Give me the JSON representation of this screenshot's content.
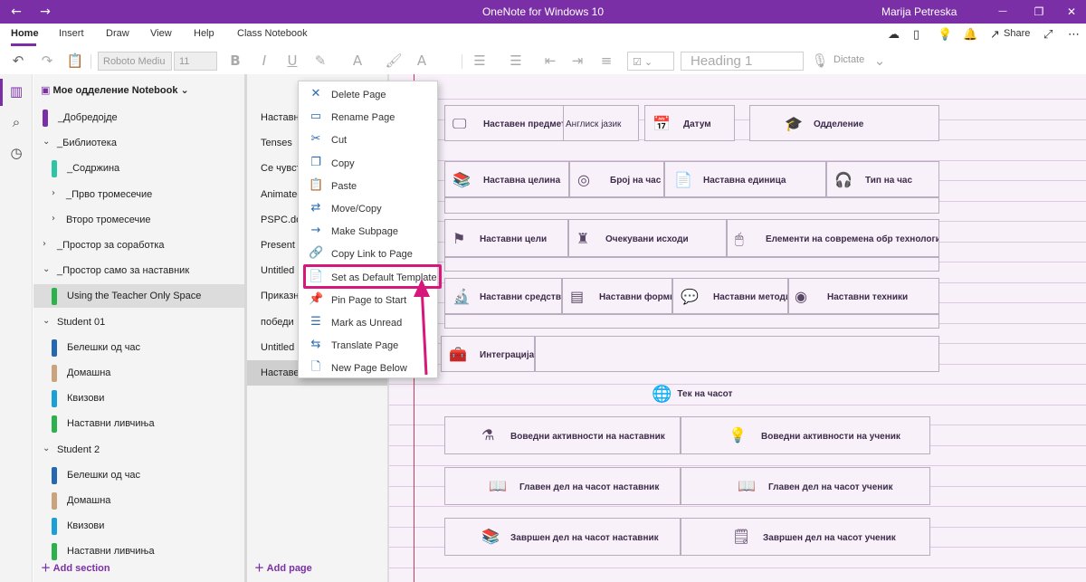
{
  "titlebar": {
    "title": "OneNote for Windows 10",
    "user": "Marija Petreska",
    "back_icon": "←",
    "forward_icon": "→",
    "minimize": "—",
    "maximize": "❐",
    "close": "✕"
  },
  "menu": {
    "items": [
      "Home",
      "Insert",
      "Draw",
      "View",
      "Help",
      "Class Notebook"
    ],
    "active": "Home",
    "share_label": "Share"
  },
  "toolbar": {
    "font_name": "Roboto Mediu",
    "font_size": "11",
    "style_value": "Heading 1",
    "dictate_label": "Dictate"
  },
  "notebook": {
    "name": "Мое одделение Notebook"
  },
  "sections": [
    {
      "label": "_Добредојде",
      "color": "#7b2fa6",
      "type": "section",
      "indent": 0
    },
    {
      "label": "_Библиотека",
      "chev": "⌄",
      "type": "group",
      "indent": 0
    },
    {
      "label": "_Содржина",
      "color": "#2ec4a6",
      "type": "section",
      "indent": 1
    },
    {
      "label": "_Прво тромесечие",
      "chev": "›",
      "type": "group",
      "indent": 1
    },
    {
      "label": "Второ тромесечие",
      "chev": "›",
      "type": "group",
      "indent": 1
    },
    {
      "label": "_Простор за соработка",
      "chev": "›",
      "type": "group",
      "indent": 0
    },
    {
      "label": "_Простор само за наставник",
      "chev": "⌄",
      "type": "group",
      "indent": 0
    },
    {
      "label": "Using the Teacher Only Space",
      "color": "#2bb24c",
      "type": "section",
      "indent": 1,
      "selected": true
    },
    {
      "label": "Student 01",
      "chev": "⌄",
      "type": "group",
      "indent": 0
    },
    {
      "label": "Белешки од час",
      "color": "#2468b2",
      "type": "section",
      "indent": 1
    },
    {
      "label": "Домашна",
      "color": "#c8a37c",
      "type": "section",
      "indent": 1
    },
    {
      "label": "Квизови",
      "color": "#1a9fd6",
      "type": "section",
      "indent": 1
    },
    {
      "label": "Наставни ливчиња",
      "color": "#2bb24c",
      "type": "section",
      "indent": 1
    },
    {
      "label": "Student 2",
      "chev": "⌄",
      "type": "group",
      "indent": 0
    },
    {
      "label": "Белешки од час",
      "color": "#2468b2",
      "type": "section",
      "indent": 1
    },
    {
      "label": "Домашна",
      "color": "#c8a37c",
      "type": "section",
      "indent": 1
    },
    {
      "label": "Квизови",
      "color": "#1a9fd6",
      "type": "section",
      "indent": 1
    },
    {
      "label": "Наставни ливчиња",
      "color": "#2bb24c",
      "type": "section",
      "indent": 1
    }
  ],
  "add_section_label": "Add section",
  "pages": [
    "Наставно",
    "Tenses",
    "Се чувст",
    "Animated",
    "PSPC.doc",
    "Present S",
    "Untitled p",
    "Приказн",
    "победи",
    "Untitled p",
    "Наставен"
  ],
  "add_page_label": "Add page",
  "context_menu": [
    {
      "label": "Delete Page",
      "icon": "✕"
    },
    {
      "label": "Rename Page",
      "icon": "▭"
    },
    {
      "label": "Cut",
      "icon": "✂"
    },
    {
      "label": "Copy",
      "icon": "❐"
    },
    {
      "label": "Paste",
      "icon": "📋"
    },
    {
      "label": "Move/Copy",
      "icon": "⇄"
    },
    {
      "label": "Make Subpage",
      "icon": "→"
    },
    {
      "label": "Copy Link to Page",
      "icon": "🔗"
    },
    {
      "label": "Set as Default Template",
      "icon": "📄"
    },
    {
      "label": "Pin Page to Start",
      "icon": "📌"
    },
    {
      "label": "Mark as Unread",
      "icon": "☰"
    },
    {
      "label": "Translate Page",
      "icon": "⇆"
    },
    {
      "label": "New Page Below",
      "icon": "🗋"
    }
  ],
  "page_content": {
    "row1": [
      "Наставен предмет",
      "Англиск јазик",
      "Датум",
      "Одделение"
    ],
    "row2": [
      "Наставна целина",
      "Број на час",
      "Наставна единица",
      "Тип на час"
    ],
    "row3": [
      "Наставни цели",
      "Очекувани исходи",
      "Елементи на современа обр технологија"
    ],
    "row4": [
      "Наставни средства",
      "Наставни форми",
      "Наставни методи",
      "Наставни техники"
    ],
    "row5": [
      "Интеграција"
    ],
    "lesson_flow": "Тек на часот",
    "activities": [
      [
        "Воведни активности на наставник",
        "Воведни активности на ученик"
      ],
      [
        "Главен дел на часот наставник",
        "Главен дел на часот ученик"
      ],
      [
        "Завршен дел на часот наставник",
        "Завршен дел на часот ученик"
      ]
    ]
  },
  "colors": {
    "accent": "#7b2fa6",
    "highlight": "#d6187a",
    "canvas": "#f8f1fa"
  }
}
